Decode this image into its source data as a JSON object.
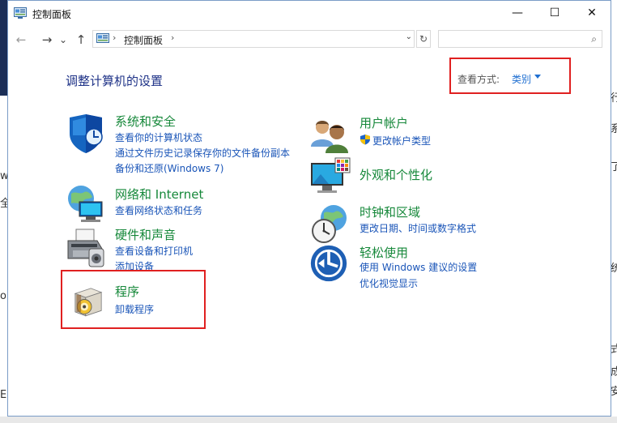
{
  "window": {
    "title": "控制面板",
    "minimize_glyph": "—",
    "maximize_glyph": "☐",
    "close_glyph": "✕"
  },
  "nav": {
    "back_glyph": "←",
    "forward_glyph": "→",
    "recent_glyph": "⌄",
    "up_glyph": "↑",
    "breadcrumb": "控制面板",
    "breadcrumb_sep": "›",
    "refresh_glyph": "↻",
    "search_placeholder": ""
  },
  "header": {
    "title": "调整计算机的设置",
    "view_by_label": "查看方式:",
    "view_by_value": "类别"
  },
  "categories": [
    {
      "title": "系统和安全",
      "icon": "shield-icon",
      "links": [
        "查看你的计算机状态",
        "通过文件历史记录保存你的文件备份副本",
        "备份和还原(Windows 7)"
      ]
    },
    {
      "title": "网络和 Internet",
      "icon": "network-icon",
      "links": [
        "查看网络状态和任务"
      ]
    },
    {
      "title": "硬件和声音",
      "icon": "printer-icon",
      "links": [
        "查看设备和打印机",
        "添加设备"
      ]
    },
    {
      "title": "程序",
      "icon": "programs-icon",
      "links": [
        "卸载程序"
      ]
    },
    {
      "title": "用户帐户",
      "icon": "users-icon",
      "links": [
        "更改帐户类型"
      ]
    },
    {
      "title": "外观和个性化",
      "icon": "monitor-icon",
      "links": []
    },
    {
      "title": "时钟和区域",
      "icon": "clock-globe-icon",
      "links": [
        "更改日期、时间或数字格式"
      ]
    },
    {
      "title": "轻松使用",
      "icon": "ease-of-access-icon",
      "links": [
        "使用 Windows 建议的设置",
        "优化视觉显示"
      ]
    }
  ],
  "background_fragments": [
    "w",
    "全",
    "o",
    "E",
    "行",
    "系",
    "了",
    "统",
    "式",
    "成",
    "安"
  ],
  "colors": {
    "heading": "#1e3287",
    "category_title": "#16883a",
    "link": "#1a55b8",
    "highlight_box": "#e02020"
  }
}
